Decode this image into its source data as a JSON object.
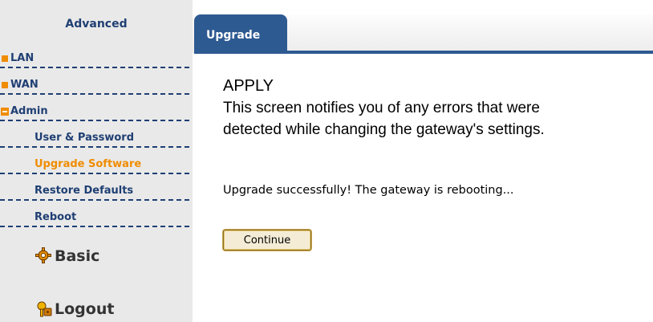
{
  "sidebar": {
    "title": "Advanced",
    "items": [
      {
        "label": "LAN"
      },
      {
        "label": "WAN"
      },
      {
        "label": "Admin"
      }
    ],
    "admin_subitems": [
      {
        "label": "User & Password"
      },
      {
        "label": "Upgrade Software",
        "active": true
      },
      {
        "label": "Restore Defaults"
      },
      {
        "label": "Reboot"
      }
    ],
    "basic_label": "Basic",
    "logout_label": "Logout",
    "basic_icon": "gear-icon",
    "logout_icon": "key-lock-icon"
  },
  "tabs": [
    {
      "label": "Upgrade",
      "active": true
    }
  ],
  "main": {
    "heading": "APPLY",
    "description_lines": [
      "This screen notifies you of any errors that were",
      "detected while changing the gateway's settings."
    ],
    "status_message": "Upgrade successfully! The gateway is rebooting...",
    "continue_label": "Continue"
  },
  "colors": {
    "accent_blue": "#2e5a92",
    "accent_orange": "#f08c00",
    "nav_text": "#1f3f73",
    "sidebar_bg": "#e9e9e9"
  }
}
